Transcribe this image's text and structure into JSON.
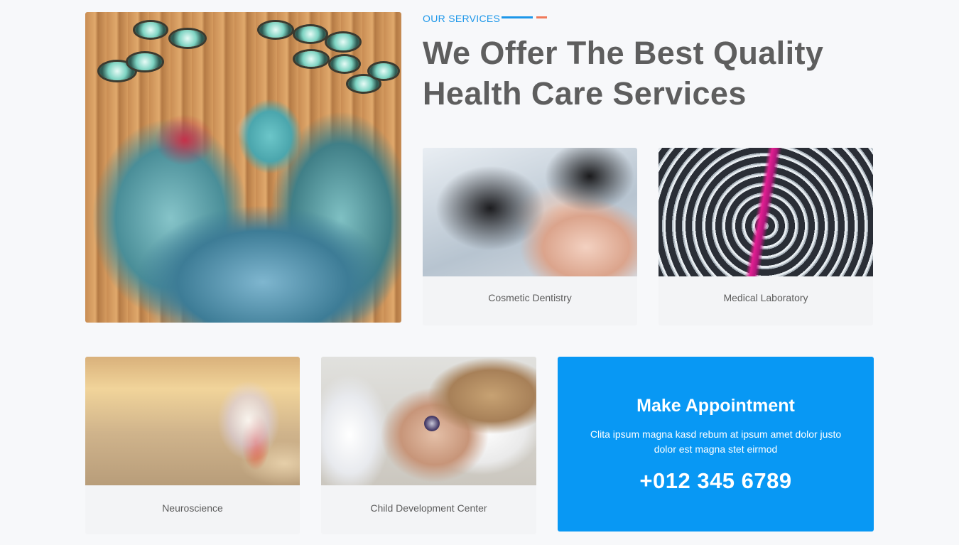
{
  "colors": {
    "accent": "#1d97e9",
    "accent_secondary": "#f07a5a",
    "panel": "#0898f4",
    "heading": "#5e5e5e"
  },
  "services": {
    "tag": "OUR SERVICES",
    "headline_line1": "We Offer The Best Quality",
    "headline_line2": "Health Care Services",
    "items": [
      {
        "label": "Cosmetic Dentistry"
      },
      {
        "label": "Medical Laboratory"
      },
      {
        "label": "Neuroscience"
      },
      {
        "label": "Child Development Center"
      }
    ]
  },
  "appointment": {
    "title": "Make Appointment",
    "text": "Clita ipsum magna kasd rebum at ipsum amet dolor justo dolor est magna stet eirmod",
    "phone": "+012 345 6789"
  }
}
